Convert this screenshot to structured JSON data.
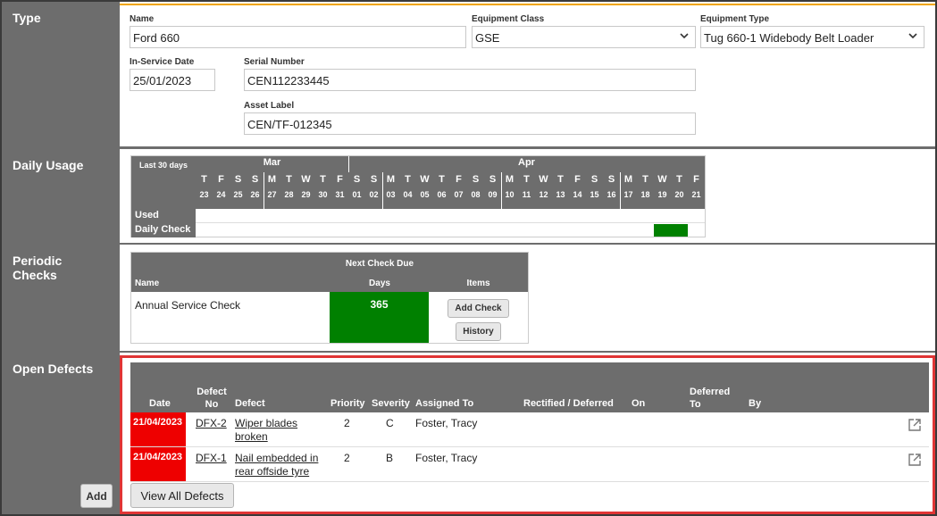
{
  "sections": {
    "type": "Type",
    "daily": "Daily Usage",
    "periodic": "Periodic Checks",
    "defects": "Open Defects"
  },
  "type": {
    "name_label": "Name",
    "name_value": "Ford 660",
    "class_label": "Equipment Class",
    "class_value": "GSE",
    "etype_label": "Equipment Type",
    "etype_value": "Tug 660-1 Widebody Belt Loader",
    "service_label": "In-Service Date",
    "service_value": "25/01/2023",
    "serial_label": "Serial Number",
    "serial_value": "CEN112233445",
    "asset_label": "Asset Label",
    "asset_value": "CEN/TF-012345"
  },
  "daily_usage": {
    "period_label": "Last 30 days",
    "months": [
      "Mar",
      "Apr"
    ],
    "days": [
      {
        "d": "T",
        "n": "23"
      },
      {
        "d": "F",
        "n": "24"
      },
      {
        "d": "S",
        "n": "25"
      },
      {
        "d": "S",
        "n": "26"
      },
      {
        "d": "M",
        "n": "27"
      },
      {
        "d": "T",
        "n": "28"
      },
      {
        "d": "W",
        "n": "29"
      },
      {
        "d": "T",
        "n": "30"
      },
      {
        "d": "F",
        "n": "31"
      },
      {
        "d": "S",
        "n": "01"
      },
      {
        "d": "S",
        "n": "02"
      },
      {
        "d": "M",
        "n": "03"
      },
      {
        "d": "T",
        "n": "04"
      },
      {
        "d": "W",
        "n": "05"
      },
      {
        "d": "T",
        "n": "06"
      },
      {
        "d": "F",
        "n": "07"
      },
      {
        "d": "S",
        "n": "08"
      },
      {
        "d": "S",
        "n": "09"
      },
      {
        "d": "M",
        "n": "10"
      },
      {
        "d": "T",
        "n": "11"
      },
      {
        "d": "W",
        "n": "12"
      },
      {
        "d": "T",
        "n": "13"
      },
      {
        "d": "F",
        "n": "14"
      },
      {
        "d": "S",
        "n": "15"
      },
      {
        "d": "S",
        "n": "16"
      },
      {
        "d": "M",
        "n": "17"
      },
      {
        "d": "T",
        "n": "18"
      },
      {
        "d": "W",
        "n": "19"
      },
      {
        "d": "T",
        "n": "20"
      },
      {
        "d": "F",
        "n": "21"
      }
    ],
    "rows": [
      "Used",
      "Daily Check"
    ],
    "daily_check_done": [
      "19",
      "20"
    ],
    "done_color": "#008000"
  },
  "periodic": {
    "next_due": "Next Check Due",
    "col_name": "Name",
    "col_days": "Days",
    "col_items": "Items",
    "check_name": "Annual Service Check",
    "days": "365",
    "days_color": "#008000",
    "add_check": "Add Check",
    "history": "History"
  },
  "defects": {
    "headers": {
      "date": "Date",
      "defect_no": "Defect No",
      "defect": "Defect",
      "priority": "Priority",
      "severity": "Severity",
      "assigned": "Assigned To",
      "rectified": "Rectified / Deferred",
      "on": "On",
      "deferred_to": "Deferred To",
      "by": "By"
    },
    "rows": [
      {
        "date": "21/04/2023",
        "no": "DFX-2",
        "defect_l1": "Wiper blades",
        "defect_l2": "broken",
        "priority": "2",
        "severity": "C",
        "assigned": "Foster, Tracy"
      },
      {
        "date": "21/04/2023",
        "no": "DFX-1",
        "defect_l1": "Nail embedded in",
        "defect_l2": "rear offside tyre",
        "priority": "2",
        "severity": "B",
        "assigned": "Foster, Tracy"
      }
    ],
    "view_all": "View All Defects",
    "add": "Add",
    "overdue_color": "#ee0000",
    "highlight_color": "#e03535"
  }
}
